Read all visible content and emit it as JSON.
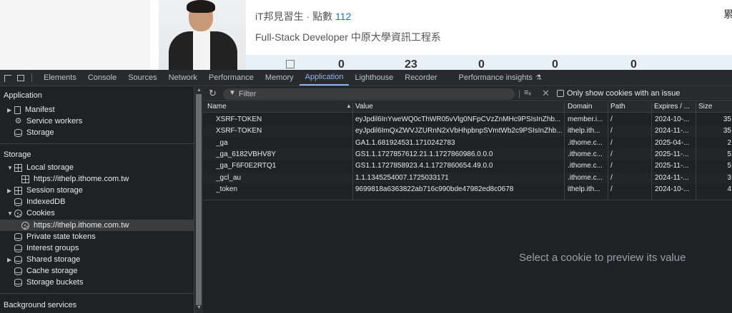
{
  "webpage": {
    "nickname_prefix": "iT邦見習生 · 點數 ",
    "points": "112",
    "bio": "Full-Stack Developer 中原大學資訊工程系",
    "stats": [
      "0",
      "23",
      "0",
      "0",
      "0"
    ],
    "corner_glyph": "累"
  },
  "devtools": {
    "tabs": [
      "Elements",
      "Console",
      "Sources",
      "Network",
      "Performance",
      "Memory",
      "Application",
      "Lighthouse",
      "Recorder",
      "Performance insights"
    ],
    "active_tab": "Application",
    "flask_icon": "⚗"
  },
  "sidebar": {
    "application_header": "Application",
    "manifest": "Manifest",
    "service_workers": "Service workers",
    "storage_app": "Storage",
    "storage_header": "Storage",
    "local_storage": "Local storage",
    "local_storage_origin": "https://ithelp.ithome.com.tw",
    "session_storage": "Session storage",
    "indexeddb": "IndexedDB",
    "cookies": "Cookies",
    "cookies_origin": "https://ithelp.ithome.com.tw",
    "private_state_tokens": "Private state tokens",
    "interest_groups": "Interest groups",
    "shared_storage": "Shared storage",
    "cache_storage": "Cache storage",
    "storage_buckets": "Storage buckets",
    "background_services_header": "Background services"
  },
  "toolbar": {
    "filter_placeholder": "Filter",
    "only_issue_label": "Only show cookies with an issue"
  },
  "table": {
    "columns": [
      "Name",
      "Value",
      "Domain",
      "Path",
      "Expires / ...",
      "Size"
    ],
    "rows": [
      {
        "name": "XSRF-TOKEN",
        "value": "eyJpdil6InYweWQ0cThWR05vVlg0NFpCVzZnMHc9PSIsInZhb...",
        "domain": "member.i...",
        "path": "/",
        "expires": "2024-10-...",
        "size": "35"
      },
      {
        "name": "XSRF-TOKEN",
        "value": "eyJpdil6ImQxZWVJZURnN2xVbHhpbnpSVmtWb2c9PSIsInZhb...",
        "domain": "ithelp.ith...",
        "path": "/",
        "expires": "2024-11-...",
        "size": "35"
      },
      {
        "name": "_ga",
        "value": "GA1.1.681924531.1710242783",
        "domain": ".ithome.c...",
        "path": "/",
        "expires": "2025-04-...",
        "size": "2"
      },
      {
        "name": "_ga_6182VBHV8Y",
        "value": "GS1.1.1727857612.21.1.1727860986.0.0.0",
        "domain": ".ithome.c...",
        "path": "/",
        "expires": "2025-11-...",
        "size": "5"
      },
      {
        "name": "_ga_F6F0E2RTQ1",
        "value": "GS1.1.1727858923.4.1.1727860654.49.0.0",
        "domain": ".ithome.c...",
        "path": "/",
        "expires": "2025-11-...",
        "size": "5"
      },
      {
        "name": "_gcl_au",
        "value": "1.1.1345254007.1725033171",
        "domain": ".ithome.c...",
        "path": "/",
        "expires": "2024-11-...",
        "size": "3"
      },
      {
        "name": "_token",
        "value": "9699818a6363822ab716c990bde47982ed8c0678",
        "domain": "ithelp.ith...",
        "path": "/",
        "expires": "2024-10-...",
        "size": "4"
      }
    ]
  },
  "preview": {
    "message": "Select a cookie to preview its value"
  }
}
